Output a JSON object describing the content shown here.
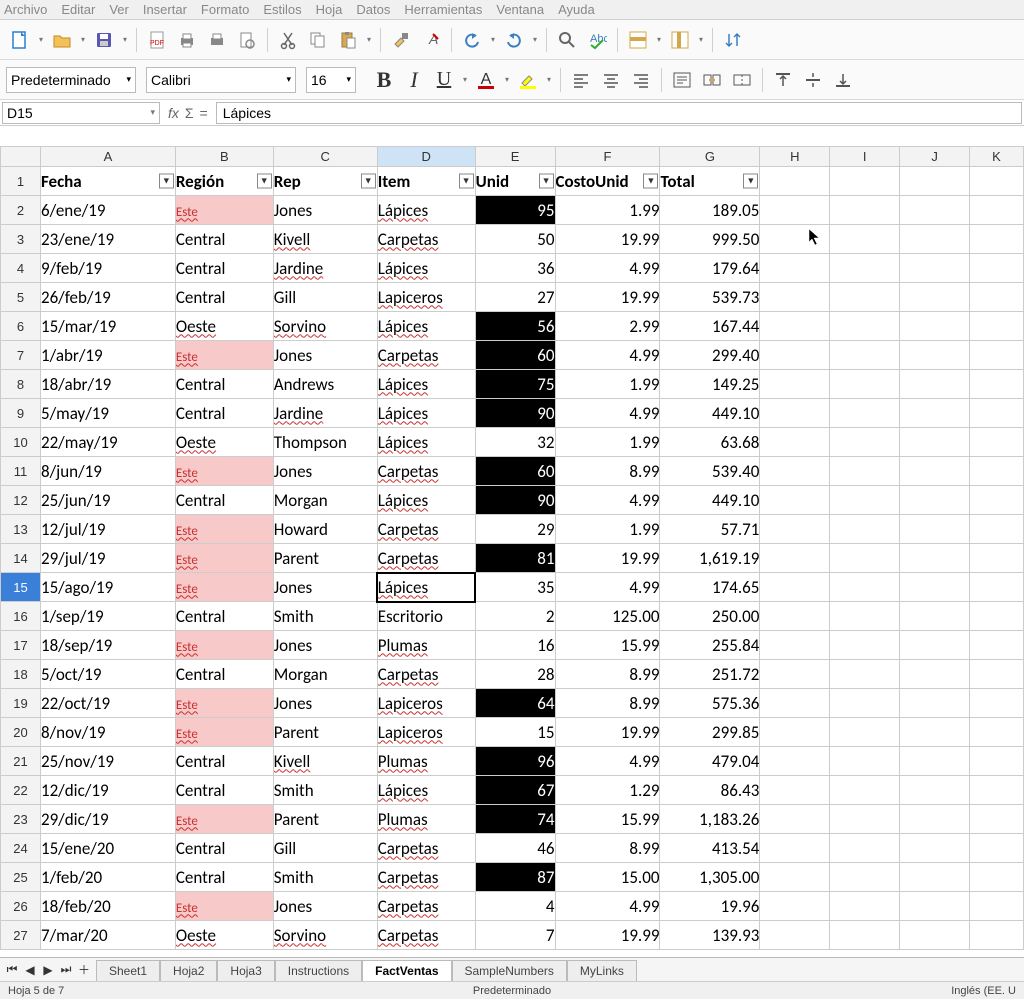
{
  "menu": [
    "Archivo",
    "Editar",
    "Ver",
    "Insertar",
    "Formato",
    "Estilos",
    "Hoja",
    "Datos",
    "Herramientas",
    "Ventana",
    "Ayuda"
  ],
  "style_combo": "Predeterminado",
  "font_combo": "Calibri",
  "size_combo": "16",
  "namebox": "D15",
  "formula": "Lápices",
  "col_headers": [
    "A",
    "B",
    "C",
    "D",
    "E",
    "F",
    "G",
    "H",
    "I",
    "J",
    "K"
  ],
  "header_row": [
    "Fecha",
    "Región",
    "Rep",
    "Item",
    "Unid",
    "CostoUnid",
    "Total"
  ],
  "rows": [
    {
      "n": 2,
      "fecha": "6/ene/19",
      "region": "Este",
      "rep": "Jones",
      "item": "Lápices",
      "unid": "95",
      "black": true,
      "costo": "1.99",
      "total": "189.05"
    },
    {
      "n": 3,
      "fecha": "23/ene/19",
      "region": "Central",
      "rep": "Kivell",
      "item": "Carpetas",
      "unid": "50",
      "black": false,
      "costo": "19.99",
      "total": "999.50"
    },
    {
      "n": 4,
      "fecha": "9/feb/19",
      "region": "Central",
      "rep": "Jardine",
      "item": "Lápices",
      "unid": "36",
      "black": false,
      "costo": "4.99",
      "total": "179.64"
    },
    {
      "n": 5,
      "fecha": "26/feb/19",
      "region": "Central",
      "rep": "Gill",
      "item": "Lapiceros",
      "unid": "27",
      "black": false,
      "costo": "19.99",
      "total": "539.73"
    },
    {
      "n": 6,
      "fecha": "15/mar/19",
      "region": "Oeste",
      "rep": "Sorvino",
      "item": "Lápices",
      "unid": "56",
      "black": true,
      "costo": "2.99",
      "total": "167.44"
    },
    {
      "n": 7,
      "fecha": "1/abr/19",
      "region": "Este",
      "rep": "Jones",
      "item": "Carpetas",
      "unid": "60",
      "black": true,
      "costo": "4.99",
      "total": "299.40"
    },
    {
      "n": 8,
      "fecha": "18/abr/19",
      "region": "Central",
      "rep": "Andrews",
      "item": "Lápices",
      "unid": "75",
      "black": true,
      "costo": "1.99",
      "total": "149.25"
    },
    {
      "n": 9,
      "fecha": "5/may/19",
      "region": "Central",
      "rep": "Jardine",
      "item": "Lápices",
      "unid": "90",
      "black": true,
      "costo": "4.99",
      "total": "449.10"
    },
    {
      "n": 10,
      "fecha": "22/may/19",
      "region": "Oeste",
      "rep": "Thompson",
      "item": "Lápices",
      "unid": "32",
      "black": false,
      "costo": "1.99",
      "total": "63.68"
    },
    {
      "n": 11,
      "fecha": "8/jun/19",
      "region": "Este",
      "rep": "Jones",
      "item": "Carpetas",
      "unid": "60",
      "black": true,
      "costo": "8.99",
      "total": "539.40"
    },
    {
      "n": 12,
      "fecha": "25/jun/19",
      "region": "Central",
      "rep": "Morgan",
      "item": "Lápices",
      "unid": "90",
      "black": true,
      "costo": "4.99",
      "total": "449.10"
    },
    {
      "n": 13,
      "fecha": "12/jul/19",
      "region": "Este",
      "rep": "Howard",
      "item": "Carpetas",
      "unid": "29",
      "black": false,
      "costo": "1.99",
      "total": "57.71"
    },
    {
      "n": 14,
      "fecha": "29/jul/19",
      "region": "Este",
      "rep": "Parent",
      "item": "Carpetas",
      "unid": "81",
      "black": true,
      "costo": "19.99",
      "total": "1,619.19"
    },
    {
      "n": 15,
      "fecha": "15/ago/19",
      "region": "Este",
      "rep": "Jones",
      "item": "Lápices",
      "unid": "35",
      "black": false,
      "costo": "4.99",
      "total": "174.65",
      "cursor": true
    },
    {
      "n": 16,
      "fecha": "1/sep/19",
      "region": "Central",
      "rep": "Smith",
      "item": "Escritorio",
      "unid": "2",
      "black": false,
      "costo": "125.00",
      "total": "250.00"
    },
    {
      "n": 17,
      "fecha": "18/sep/19",
      "region": "Este",
      "rep": "Jones",
      "item": "Plumas",
      "unid": "16",
      "black": false,
      "costo": "15.99",
      "total": "255.84"
    },
    {
      "n": 18,
      "fecha": "5/oct/19",
      "region": "Central",
      "rep": "Morgan",
      "item": "Carpetas",
      "unid": "28",
      "black": false,
      "costo": "8.99",
      "total": "251.72"
    },
    {
      "n": 19,
      "fecha": "22/oct/19",
      "region": "Este",
      "rep": "Jones",
      "item": "Lapiceros",
      "unid": "64",
      "black": true,
      "costo": "8.99",
      "total": "575.36"
    },
    {
      "n": 20,
      "fecha": "8/nov/19",
      "region": "Este",
      "rep": "Parent",
      "item": "Lapiceros",
      "unid": "15",
      "black": false,
      "costo": "19.99",
      "total": "299.85"
    },
    {
      "n": 21,
      "fecha": "25/nov/19",
      "region": "Central",
      "rep": "Kivell",
      "item": "Plumas",
      "unid": "96",
      "black": true,
      "costo": "4.99",
      "total": "479.04"
    },
    {
      "n": 22,
      "fecha": "12/dic/19",
      "region": "Central",
      "rep": "Smith",
      "item": "Lápices",
      "unid": "67",
      "black": true,
      "costo": "1.29",
      "total": "86.43"
    },
    {
      "n": 23,
      "fecha": "29/dic/19",
      "region": "Este",
      "rep": "Parent",
      "item": "Plumas",
      "unid": "74",
      "black": true,
      "costo": "15.99",
      "total": "1,183.26"
    },
    {
      "n": 24,
      "fecha": "15/ene/20",
      "region": "Central",
      "rep": "Gill",
      "item": "Carpetas",
      "unid": "46",
      "black": false,
      "costo": "8.99",
      "total": "413.54"
    },
    {
      "n": 25,
      "fecha": "1/feb/20",
      "region": "Central",
      "rep": "Smith",
      "item": "Carpetas",
      "unid": "87",
      "black": true,
      "costo": "15.00",
      "total": "1,305.00"
    },
    {
      "n": 26,
      "fecha": "18/feb/20",
      "region": "Este",
      "rep": "Jones",
      "item": "Carpetas",
      "unid": "4",
      "black": false,
      "costo": "4.99",
      "total": "19.96"
    },
    {
      "n": 27,
      "fecha": "7/mar/20",
      "region": "Oeste",
      "rep": "Sorvino",
      "item": "Carpetas",
      "unid": "7",
      "black": false,
      "costo": "19.99",
      "total": "139.93"
    }
  ],
  "col_widths": {
    "row": 40,
    "A": 135,
    "B": 98,
    "C": 104,
    "D": 98,
    "E": 80,
    "F": 105,
    "G": 100,
    "H": 70,
    "I": 70,
    "J": 70,
    "K": 54
  },
  "tabs": [
    "Sheet1",
    "Hoja2",
    "Hoja3",
    "Instructions",
    "FactVentas",
    "SampleNumbers",
    "MyLinks"
  ],
  "active_tab": "FactVentas",
  "status_left": "Hoja 5 de 7",
  "status_mid": "Predeterminado",
  "status_right": "Inglés (EE. U"
}
